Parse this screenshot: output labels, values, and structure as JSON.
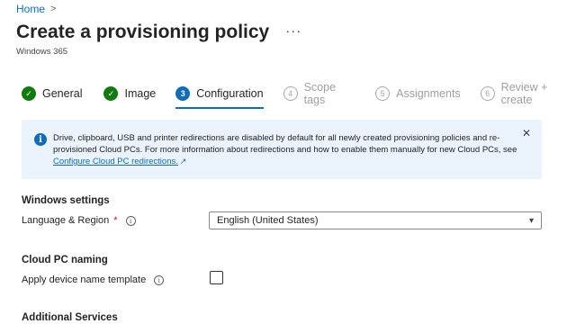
{
  "breadcrumb": {
    "home": "Home",
    "separator": ">"
  },
  "header": {
    "title": "Create a provisioning policy",
    "more": "···",
    "subtitle": "Windows 365"
  },
  "steps": [
    {
      "num": "✓",
      "label": "General",
      "state": "done"
    },
    {
      "num": "✓",
      "label": "Image",
      "state": "done"
    },
    {
      "num": "3",
      "label": "Configuration",
      "state": "current"
    },
    {
      "num": "4",
      "label": "Scope tags",
      "state": "todo"
    },
    {
      "num": "5",
      "label": "Assignments",
      "state": "todo"
    },
    {
      "num": "6",
      "label": "Review + create",
      "state": "todo"
    }
  ],
  "info": {
    "icon": "i",
    "text_1": "Drive, clipboard, USB and printer redirections are disabled by default for all newly created provisioning policies and re-provisioned Cloud PCs. For more information about redirections and how to enable them manually for new Cloud PCs, see ",
    "link": "Configure Cloud PC redirections.",
    "close": "✕"
  },
  "windows_settings": {
    "heading": "Windows settings",
    "language_label": "Language & Region",
    "required_mark": "*",
    "language_value": "English (United States)"
  },
  "naming": {
    "heading": "Cloud PC naming",
    "template_label": "Apply device name template",
    "template_checked": false
  },
  "additional": {
    "heading": "Additional Services"
  },
  "colors": {
    "accent": "#0f6cbd",
    "success": "#107c10",
    "info_bg": "#ebf3fc",
    "required": "#c50f1f"
  }
}
